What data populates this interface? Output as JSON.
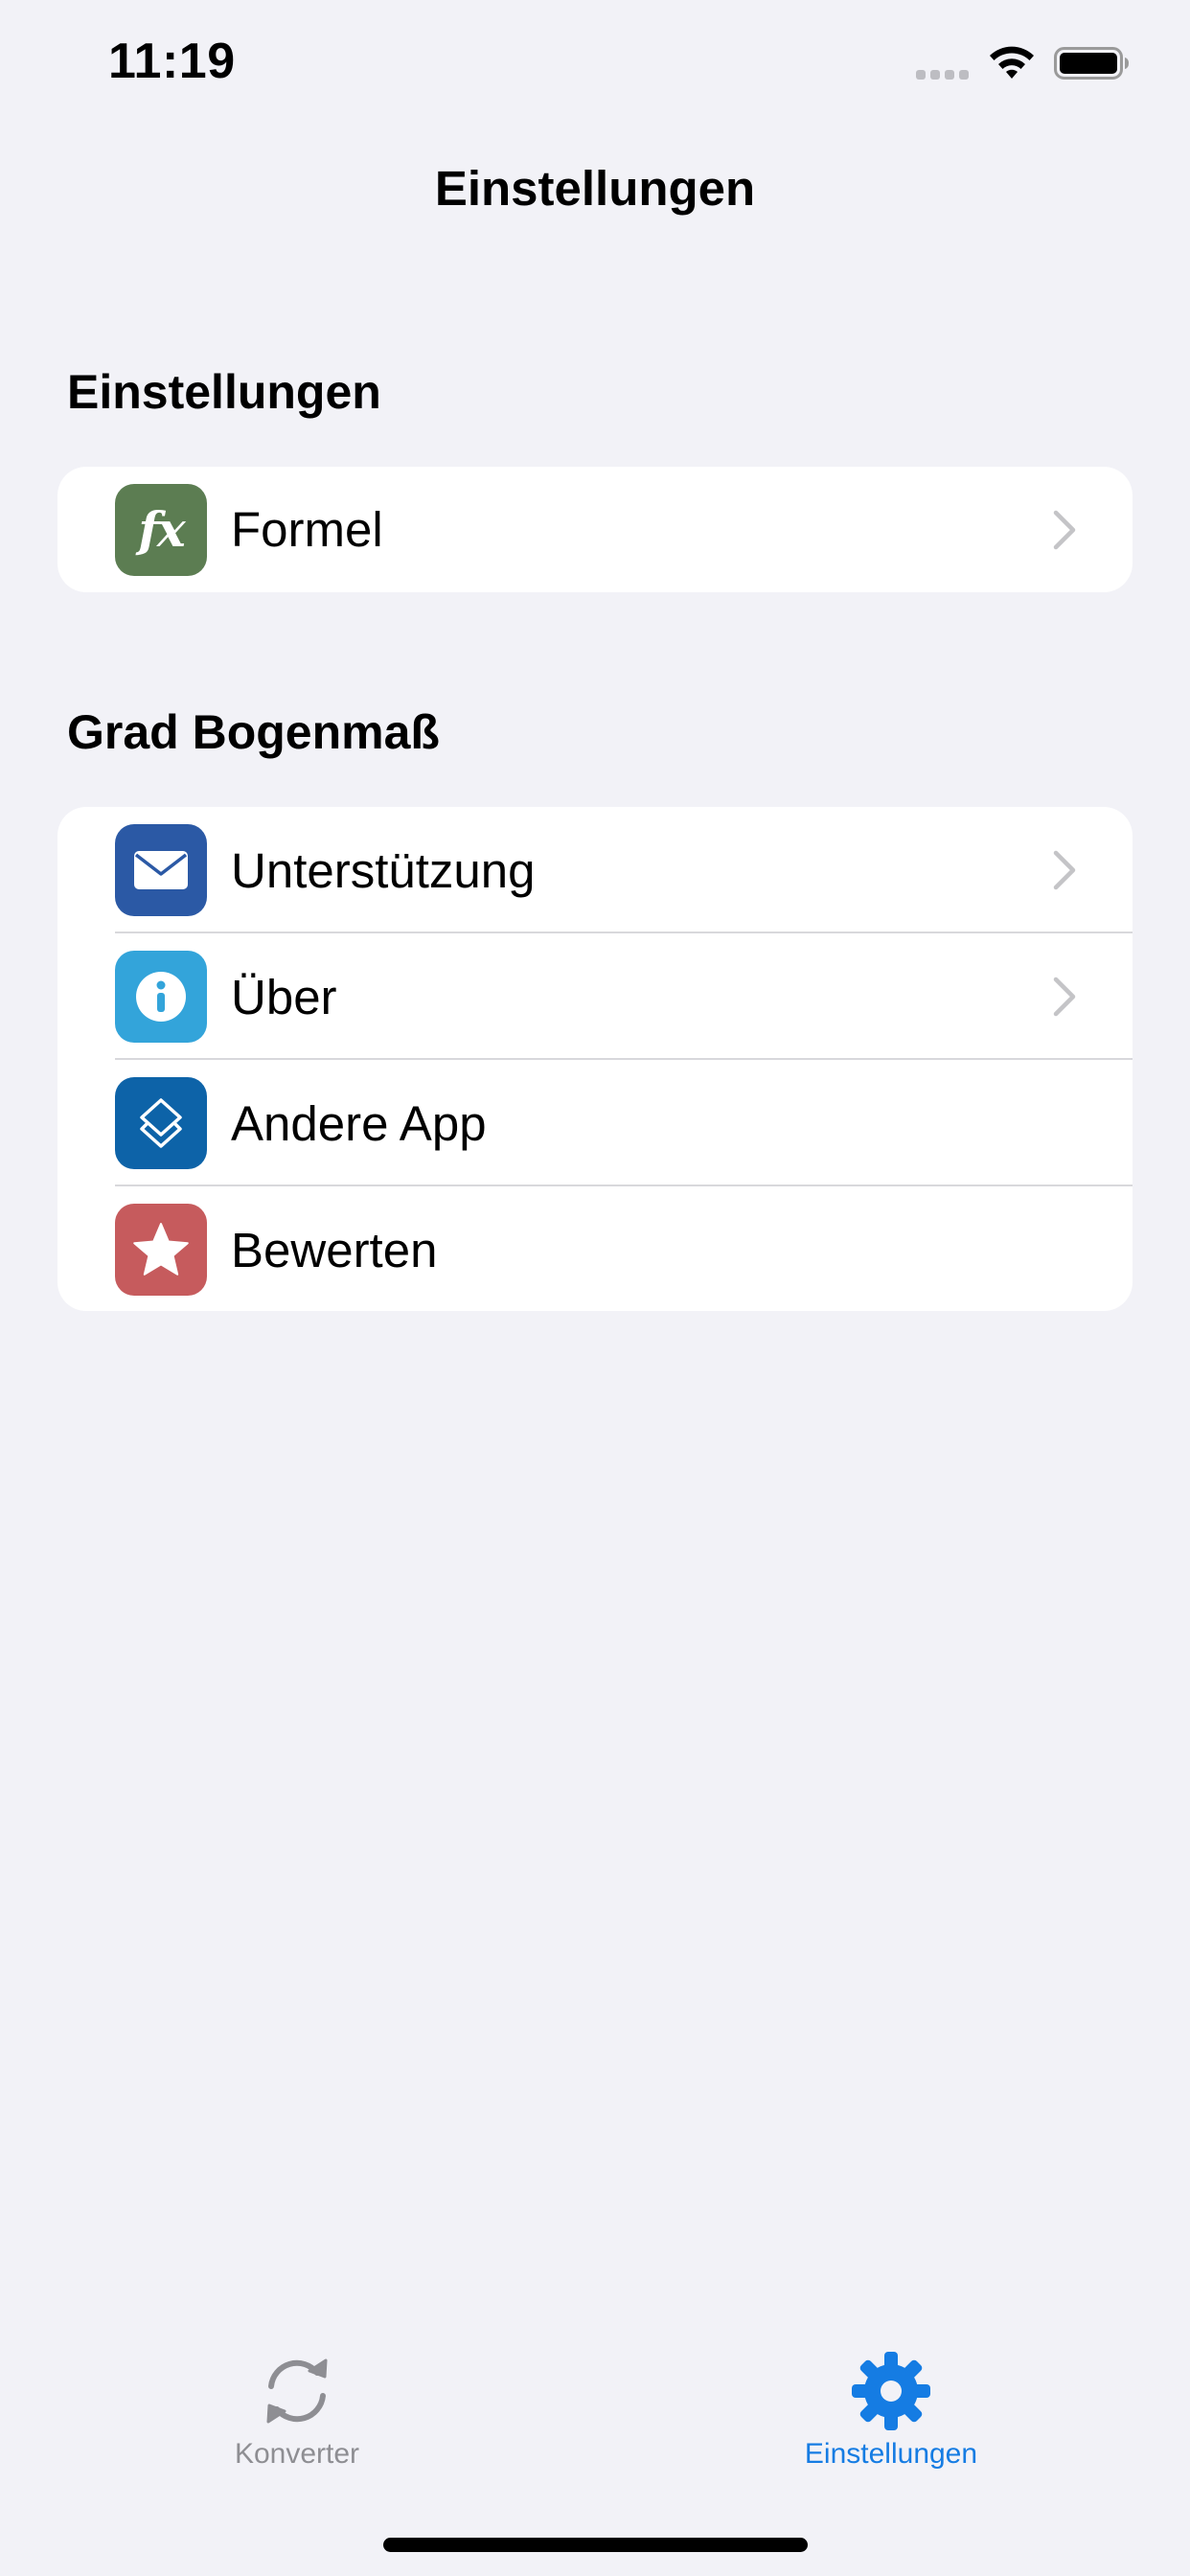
{
  "status_bar": {
    "time": "11:19",
    "icons": [
      "signal-dots-icon",
      "wifi-icon",
      "battery-icon"
    ]
  },
  "nav": {
    "title": "Einstellungen"
  },
  "sections": [
    {
      "header": "Einstellungen",
      "rows": [
        {
          "label": "Formel",
          "icon": "formula-fx-icon",
          "icon_color": "#5c7d52",
          "has_chevron": true
        }
      ]
    },
    {
      "header": "Grad Bogenmaß",
      "rows": [
        {
          "label": "Unterstützung",
          "icon": "envelope-icon",
          "icon_color": "#2b59a5",
          "has_chevron": true
        },
        {
          "label": "Über",
          "icon": "info-icon",
          "icon_color": "#33a4da",
          "has_chevron": true
        },
        {
          "label": "Andere App",
          "icon": "app-stack-icon",
          "icon_color": "#0d63a8",
          "has_chevron": false
        },
        {
          "label": "Bewerten",
          "icon": "star-icon",
          "icon_color": "#c65b5d",
          "has_chevron": false
        }
      ]
    }
  ],
  "formel_icon_text": "fx",
  "tab_bar": {
    "tabs": [
      {
        "label": "Konverter",
        "icon": "convert-arrows-icon",
        "selected": false,
        "color": "#8e8e93"
      },
      {
        "label": "Einstellungen",
        "icon": "gear-icon",
        "selected": true,
        "color": "#157ce3"
      }
    ]
  },
  "colors": {
    "background": "#f2f2f7",
    "accent": "#157ce3"
  }
}
